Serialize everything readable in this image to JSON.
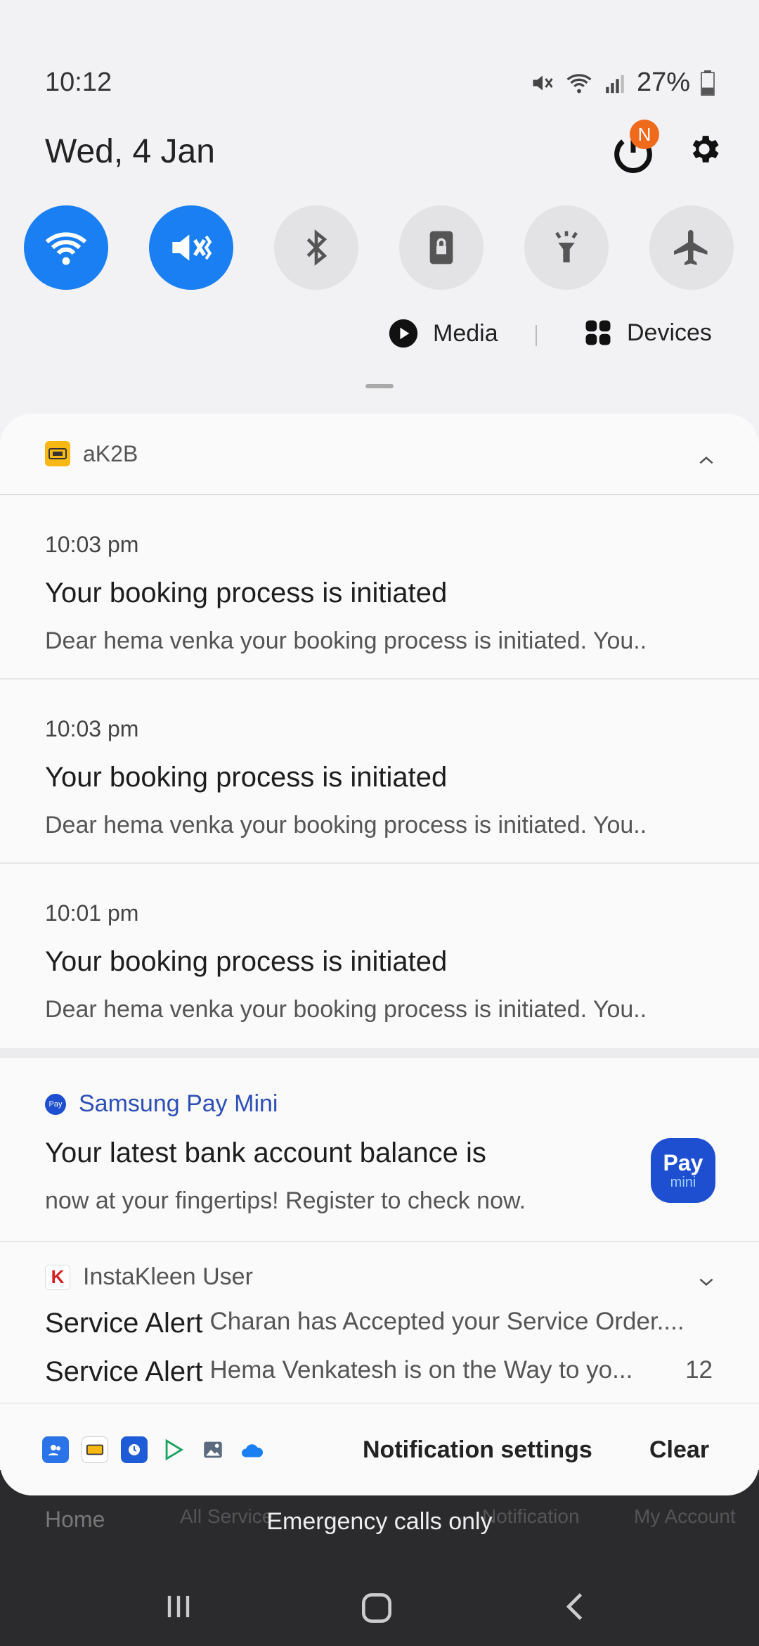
{
  "status": {
    "time": "10:12",
    "battery": "27%"
  },
  "date": "Wed, 4 Jan",
  "power_badge": "N",
  "media": {
    "media_label": "Media",
    "devices_label": "Devices"
  },
  "groups": {
    "ak2b": {
      "app_name": "aK2B",
      "notifications": [
        {
          "time": "10:03 pm",
          "title": "Your booking process is initiated",
          "body": "Dear hema venka your booking process is initiated. You.."
        },
        {
          "time": "10:03 pm",
          "title": "Your booking process is initiated",
          "body": "Dear hema venka your booking process is initiated. You.."
        },
        {
          "time": "10:01 pm",
          "title": "Your booking process is initiated",
          "body": "Dear hema venka your booking process is initiated. You.."
        }
      ]
    },
    "spay": {
      "app_name": "Samsung Pay Mini",
      "title": "Your latest bank account balance is",
      "body": "now at your fingertips! Register to check now.",
      "logo_top": "Pay",
      "logo_bottom": "mini",
      "icon_text": "Pay"
    },
    "insta": {
      "app_name": "InstaKleen User",
      "lines": [
        {
          "label": "Service Alert",
          "text": "Charan has Accepted your Service Order...."
        },
        {
          "label": "Service Alert",
          "text": "Hema Venkatesh is on the Way to yo...",
          "count": "12"
        }
      ]
    }
  },
  "footer": {
    "settings_label": "Notification settings",
    "clear_label": "Clear"
  },
  "underlay": {
    "home": "Home",
    "all_service": "All Service",
    "notification": "Notification",
    "my_account": "My Account",
    "emergency": "Emergency calls only"
  },
  "colors": {
    "accent": "#1a7ff2",
    "badge": "#f06a1c",
    "spay_blue": "#2d4fb8"
  }
}
